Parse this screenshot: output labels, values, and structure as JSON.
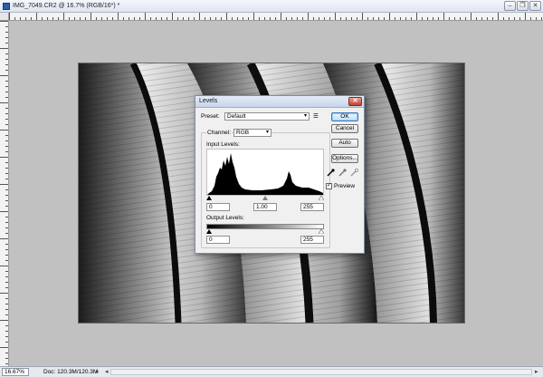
{
  "window": {
    "title": "IMG_7049.CR2 @ 16.7% (RGB/16*) *",
    "minimize": "–",
    "restore": "❐",
    "close": "✕"
  },
  "statusbar": {
    "zoom": "16.67%",
    "doc_info": "Doc: 120.3M/120.3M",
    "nav_arrow": "▸",
    "scroll_left_arrow": "◂",
    "scroll_right_arrow": "▸"
  },
  "levels_dialog": {
    "title": "Levels",
    "close_glyph": "✕",
    "preset_label": "Preset:",
    "preset_value": "Default",
    "preset_options_glyph": "☰",
    "channel_label": "Channel:",
    "channel_value": "RGB",
    "input_levels_label": "Input Levels:",
    "input_black": "0",
    "input_gamma": "1.00",
    "input_white": "255",
    "output_levels_label": "Output Levels:",
    "output_black": "0",
    "output_white": "255",
    "buttons": {
      "ok": "OK",
      "cancel": "Cancel",
      "auto": "Auto",
      "options": "Options..."
    },
    "preview_label": "Preview",
    "preview_checked": true,
    "check_glyph": "✓",
    "dropdown_glyph": "▾"
  },
  "colors": {
    "title_gradient_top": "#f4f7fc",
    "dialog_bg": "#f0f0f0",
    "ok_button_border": "#3a77c2",
    "close_button": "#c3412c"
  },
  "icons": {
    "app": "photoshop-document-icon",
    "eyedroppers": [
      "black-point-eyedropper-icon",
      "gray-point-eyedropper-icon",
      "white-point-eyedropper-icon"
    ]
  }
}
